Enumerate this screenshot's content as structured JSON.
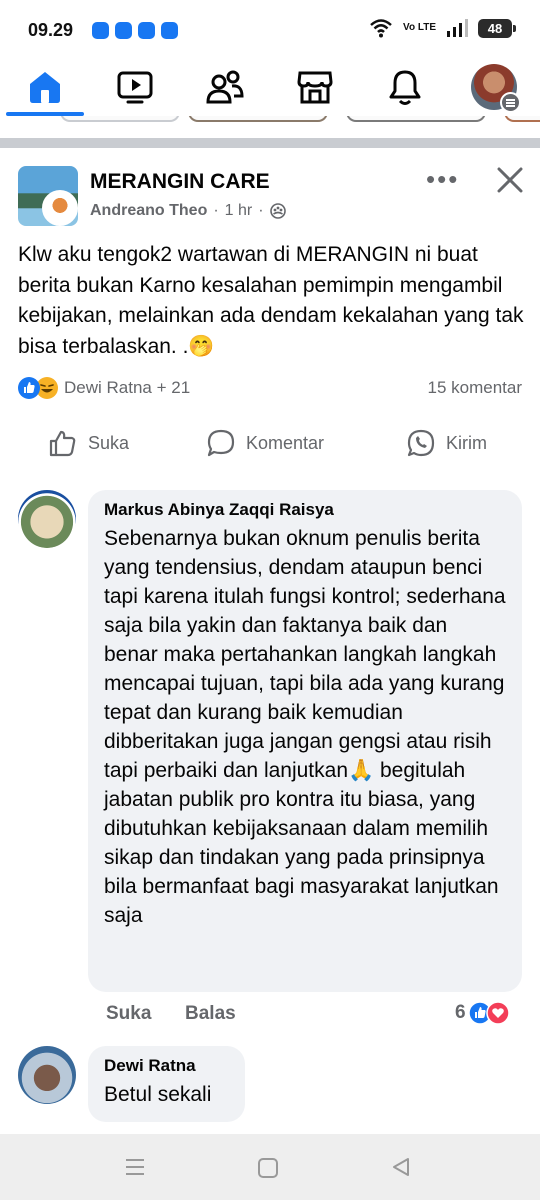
{
  "status": {
    "time": "09.29",
    "network": "Vo LTE",
    "battery": "48"
  },
  "nav": {
    "items": [
      "home-icon",
      "video-icon",
      "friends-icon",
      "marketplace-icon",
      "bell-icon",
      "profile-avatar"
    ],
    "accent": "#1877f2"
  },
  "post": {
    "group": "MERANGIN CARE",
    "author": "Andreano Theo",
    "time": "1 hr",
    "separator": "·",
    "more": "•••",
    "text": "Klw aku tengok2 wartawan di MERANGIN ni buat berita bukan Karno kesalahan pemimpin mengambil kebijakan, melainkan ada dendam kekalahan yang tak bisa terbalaskan. .🤭",
    "reactors": "Dewi Ratna + 21",
    "comment_count": "15 komentar",
    "actions": {
      "like": "Suka",
      "comment": "Komentar",
      "send": "Kirim"
    }
  },
  "comments": [
    {
      "name": "Markus Abinya Zaqqi Raisya",
      "text": "Sebenarnya bukan oknum penulis berita yang tendensius, dendam ataupun benci tapi karena itulah fungsi kontrol; sederhana saja bila yakin dan faktanya baik dan benar maka pertahankan langkah langkah mencapai tujuan, tapi bila ada yang kurang tepat dan kurang baik kemudian dibberitakan juga jangan gengsi atau risih tapi perbaiki dan lanjutkan🙏 begitulah jabatan publik pro kontra itu biasa, yang dibutuhkan kebijaksanaan dalam memilih sikap dan tindakan yang pada prinsipnya bila bermanfaat bagi masyarakat lanjutkan saja",
      "like": "Suka",
      "reply": "Balas",
      "reaction_count": "6"
    },
    {
      "name": "Dewi Ratna",
      "text": "Betul sekali"
    }
  ]
}
